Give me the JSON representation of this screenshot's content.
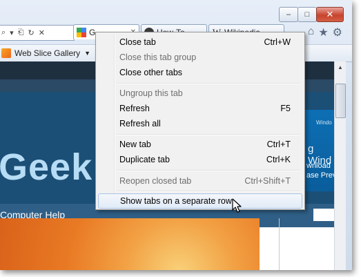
{
  "window": {
    "buttons": [
      "minimize",
      "maximize",
      "close"
    ]
  },
  "tabs": [
    {
      "label": "G",
      "icon": "google-icon",
      "active": true
    },
    {
      "label": "How-To",
      "icon": "howtogeek-icon",
      "active": false
    },
    {
      "label": "Wikipedia",
      "icon": "wikipedia-icon",
      "active": false
    }
  ],
  "favorites_bar": {
    "web_slice_gallery": "Web Slice Gallery"
  },
  "page": {
    "logo_text": "Geek",
    "nav_text": "Computer Help",
    "ad_line1": "Windo",
    "ad_line2": "g Wind",
    "ad_line3": "wnload\nase Prev"
  },
  "context_menu": {
    "items": [
      {
        "label": "Close tab",
        "shortcut": "Ctrl+W",
        "disabled": false
      },
      {
        "label": "Close this tab group",
        "shortcut": "",
        "disabled": true
      },
      {
        "label": "Close other tabs",
        "shortcut": "",
        "disabled": false
      },
      {
        "label": "Ungroup this tab",
        "shortcut": "",
        "disabled": true
      },
      {
        "label": "Refresh",
        "shortcut": "F5",
        "disabled": false
      },
      {
        "label": "Refresh all",
        "shortcut": "",
        "disabled": false
      },
      {
        "label": "New tab",
        "shortcut": "Ctrl+T",
        "disabled": false
      },
      {
        "label": "Duplicate tab",
        "shortcut": "Ctrl+K",
        "disabled": false
      },
      {
        "label": "Reopen closed tab",
        "shortcut": "Ctrl+Shift+T",
        "disabled": true
      },
      {
        "label": "Show tabs on a separate row",
        "shortcut": "",
        "disabled": false,
        "highlighted": true
      }
    ]
  },
  "colors": {
    "hero": "#1b4f76",
    "logo": "#b7dcf5",
    "menu_bg": "#f1f1f1",
    "highlight_border": "#a8c3e6"
  }
}
